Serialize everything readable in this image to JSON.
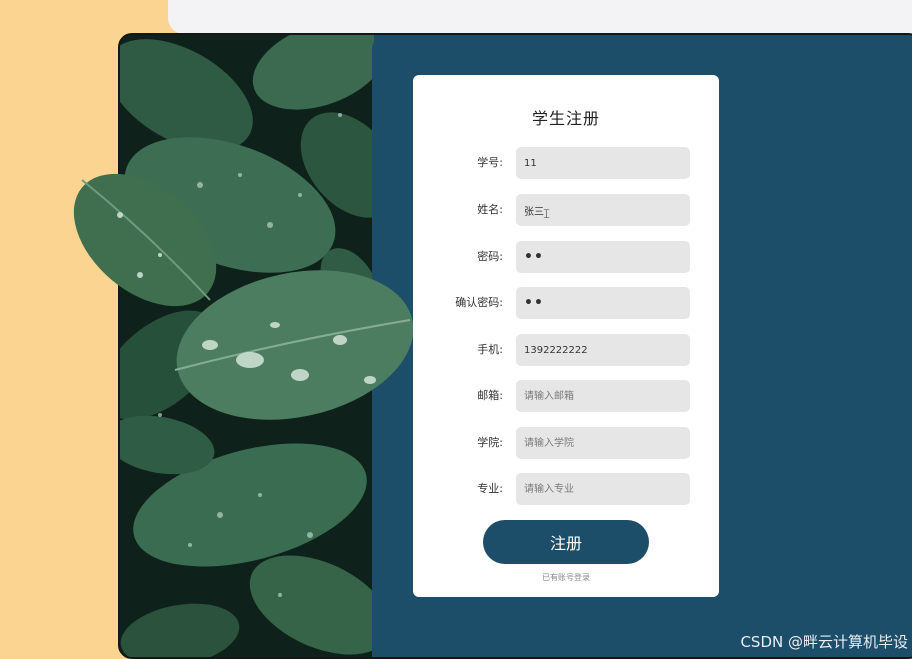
{
  "form": {
    "title": "学生注册",
    "fields": [
      {
        "label": "学号:",
        "value": "11",
        "placeholder": ""
      },
      {
        "label": "姓名:",
        "value": "张三",
        "placeholder": ""
      },
      {
        "label": "密码:",
        "value": "••",
        "placeholder": ""
      },
      {
        "label": "确认密码:",
        "value": "••",
        "placeholder": ""
      },
      {
        "label": "手机:",
        "value": "1392222222",
        "placeholder": ""
      },
      {
        "label": "邮箱:",
        "value": "",
        "placeholder": "请输入邮箱"
      },
      {
        "label": "学院:",
        "value": "",
        "placeholder": "请输入学院"
      },
      {
        "label": "专业:",
        "value": "",
        "placeholder": "请输入专业"
      }
    ],
    "submit_label": "注册",
    "login_link": "已有账号登录"
  },
  "watermark": "CSDN @畔云计算机毕设",
  "colors": {
    "panel": "#1c4e6a",
    "background": "#fcd492",
    "input": "#e6e6e6"
  }
}
